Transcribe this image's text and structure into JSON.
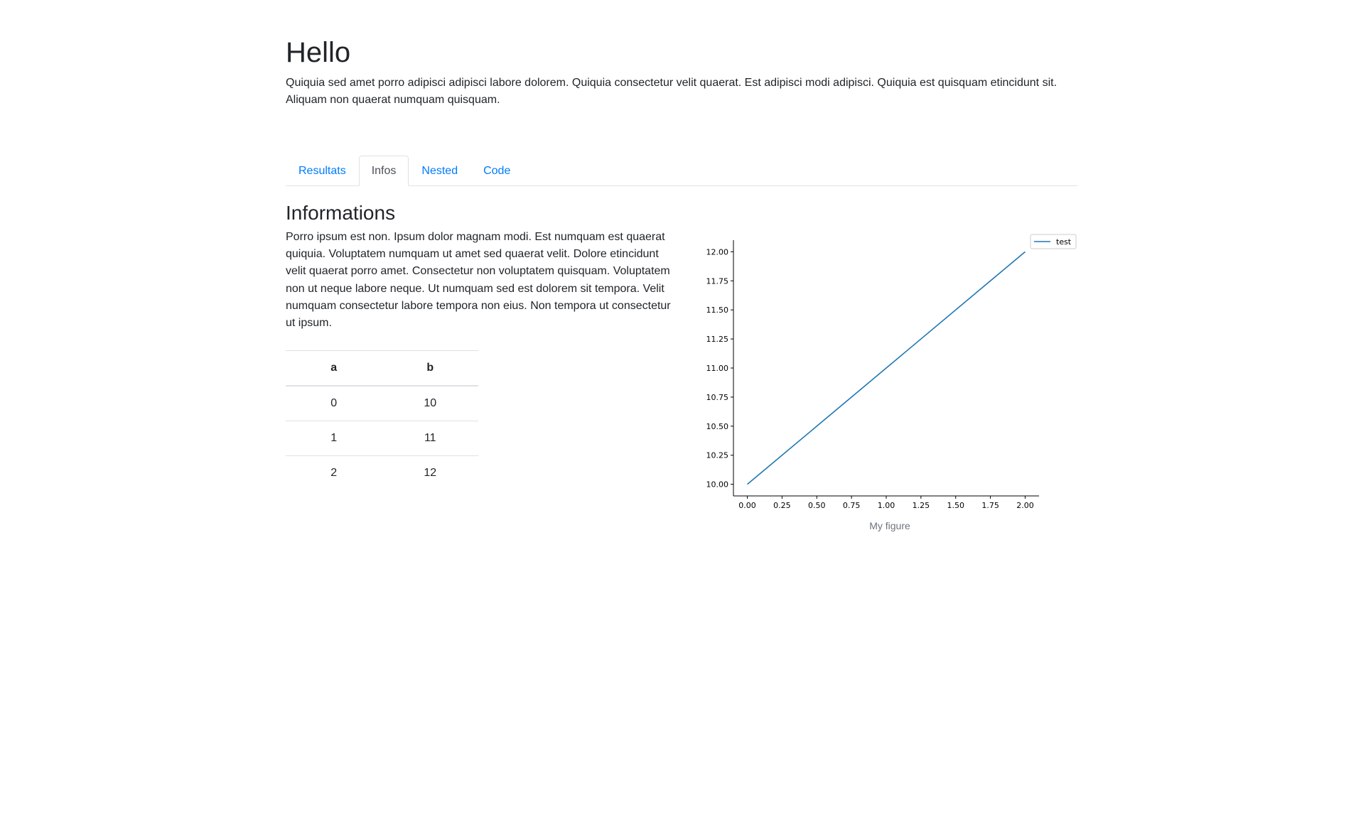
{
  "header": {
    "title": "Hello",
    "intro": "Quiquia sed amet porro adipisci adipisci labore dolorem. Quiquia consectetur velit quaerat. Est adipisci modi adipisci. Quiquia est quisquam etincidunt sit. Aliquam non quaerat numquam quisquam."
  },
  "tabs": [
    {
      "label": "Resultats",
      "active": false
    },
    {
      "label": "Infos",
      "active": true
    },
    {
      "label": "Nested",
      "active": false
    },
    {
      "label": "Code",
      "active": false
    }
  ],
  "section": {
    "heading": "Informations",
    "text": "Porro ipsum est non. Ipsum dolor magnam modi. Est numquam est quaerat quiquia. Voluptatem numquam ut amet sed quaerat velit. Dolore etincidunt velit quaerat porro amet. Consectetur non voluptatem quisquam. Voluptatem non ut neque labore neque. Ut numquam sed est dolorem sit tempora. Velit numquam consectetur labore tempora non eius. Non tempora ut consectetur ut ipsum."
  },
  "table": {
    "columns": [
      "a",
      "b"
    ],
    "rows": [
      [
        "0",
        "10"
      ],
      [
        "1",
        "11"
      ],
      [
        "2",
        "12"
      ]
    ]
  },
  "figure": {
    "caption": "My figure"
  },
  "chart_data": {
    "type": "line",
    "x": [
      0,
      2
    ],
    "series": [
      {
        "name": "test",
        "values": [
          10,
          12
        ],
        "color": "#1f77b4"
      }
    ],
    "xticks": [
      "0.00",
      "0.25",
      "0.50",
      "0.75",
      "1.00",
      "1.25",
      "1.50",
      "1.75",
      "2.00"
    ],
    "yticks": [
      "10.00",
      "10.25",
      "10.50",
      "10.75",
      "11.00",
      "11.25",
      "11.50",
      "11.75",
      "12.00"
    ],
    "xlim": [
      -0.1,
      2.1
    ],
    "ylim": [
      9.9,
      12.1
    ],
    "legend": "top-right",
    "grid": false
  }
}
